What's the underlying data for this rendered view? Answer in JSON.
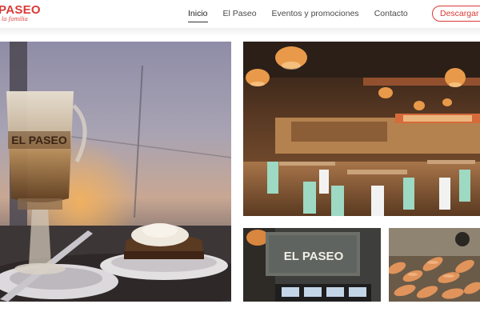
{
  "brand": {
    "name": "PASEO",
    "tagline": "la familia",
    "color": "#d93a35"
  },
  "nav": {
    "items": [
      {
        "label": "Inicio",
        "active": true
      },
      {
        "label": "El Paseo",
        "active": false
      },
      {
        "label": "Eventos y promociones",
        "active": false
      },
      {
        "label": "Contacto",
        "active": false
      }
    ],
    "download_label": "Descargar c"
  },
  "gallery": {
    "coffee": {
      "cup_text": "EL PASEO"
    },
    "sign": {
      "sign_text": "EL PASEO"
    },
    "icons": [
      "restaurant-interior-photo",
      "coffee-dessert-photo",
      "storefront-sign-photo",
      "food-photo"
    ]
  }
}
